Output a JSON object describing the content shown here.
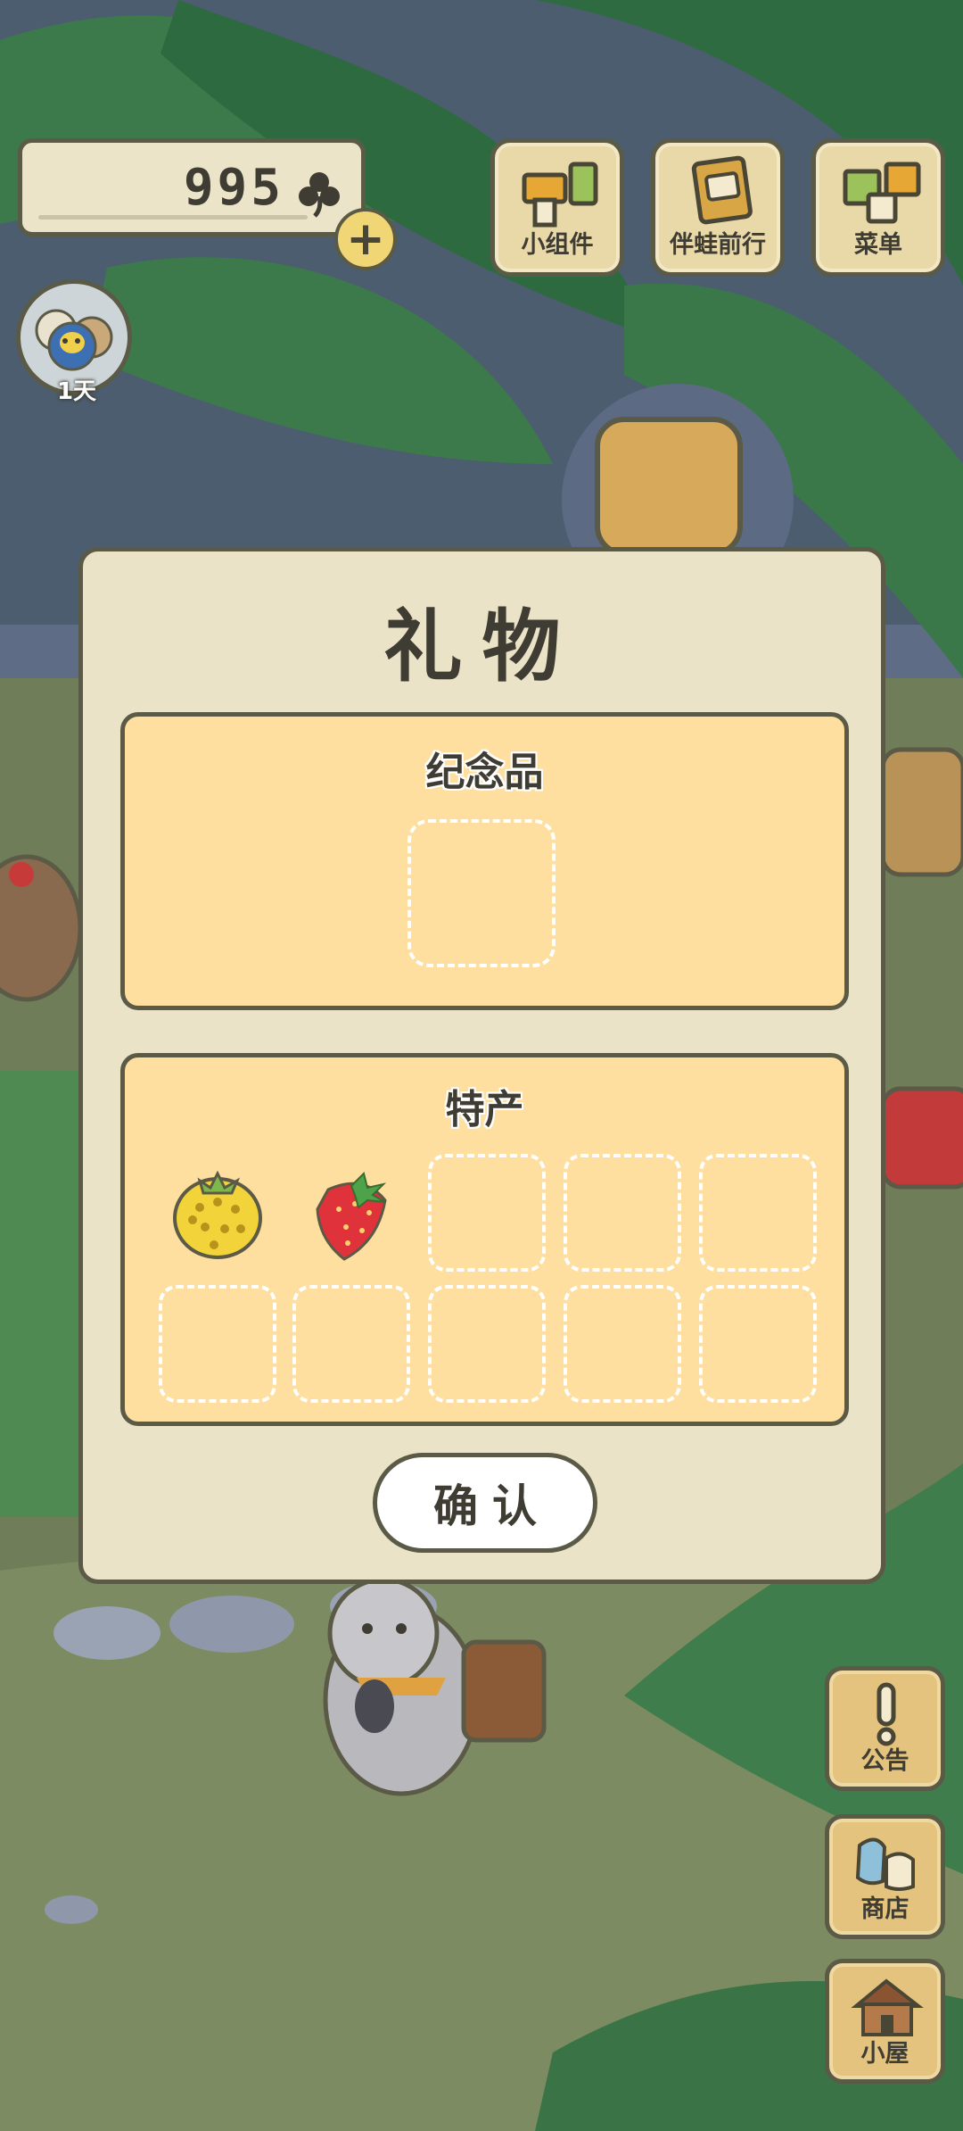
{
  "hud": {
    "currency_value": "995",
    "currency_icon": "clover-icon",
    "add_label": "+",
    "avatar_day": "1天",
    "buttons": [
      {
        "label": "小组件",
        "icon": "widget-icon"
      },
      {
        "label": "伴蛙前行",
        "icon": "journey-icon"
      },
      {
        "label": "菜单",
        "icon": "menu-icon"
      }
    ]
  },
  "side": [
    {
      "label": "公告",
      "icon": "notice-icon"
    },
    {
      "label": "商店",
      "icon": "shop-icon"
    },
    {
      "label": "小屋",
      "icon": "house-icon"
    }
  ],
  "dialog": {
    "title": "礼物",
    "souvenir_title": "纪念品",
    "specialty_title": "特产",
    "specialty_items": [
      "kiwano-melon-icon",
      "strawberry-icon"
    ],
    "confirm_label": "确认"
  },
  "colors": {
    "panel": "#fedf9f",
    "dialog": "#ebe3c8",
    "outline": "#5b5a46",
    "button_wood": "#e3c37d"
  }
}
